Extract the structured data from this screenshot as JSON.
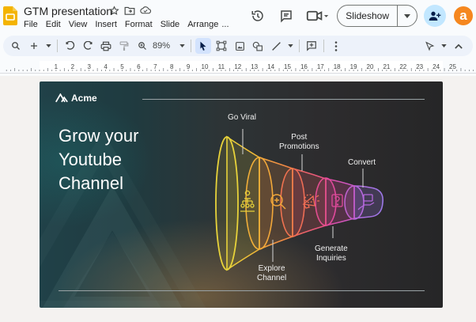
{
  "app": {
    "title": "GTM presentation",
    "menu": [
      "File",
      "Edit",
      "View",
      "Insert",
      "Format",
      "Slide",
      "Arrange",
      "..."
    ],
    "slideshow_label": "Slideshow",
    "avatar_letter": "a"
  },
  "toolbar": {
    "zoom": "89%"
  },
  "ruler": {
    "numbers": [
      "1",
      "2",
      "3",
      "4",
      "5",
      "6",
      "7",
      "8",
      "9",
      "10",
      "11",
      "12",
      "13",
      "14",
      "15",
      "16",
      "17",
      "18",
      "19",
      "20",
      "21",
      "22",
      "23",
      "24",
      "25"
    ]
  },
  "slide": {
    "brand": "Acme",
    "headline_lines": [
      "Grow your",
      "Youtube",
      "Channel"
    ],
    "stages": {
      "go_viral": "Go Viral",
      "explore": [
        "Explore",
        "Channel"
      ],
      "post_promotions": [
        "Post",
        "Promotions"
      ],
      "generate_inquiries": [
        "Generate",
        "Inquiries"
      ],
      "convert": "Convert"
    }
  },
  "colors": {
    "accent_blue": "#c2e7ff",
    "avatar_orange": "#f5871f",
    "funnel_yellow": "#e8d33a",
    "funnel_orange": "#f0913c",
    "funnel_pink": "#e85c77",
    "funnel_magenta": "#d94da8",
    "funnel_violet": "#a86de0"
  }
}
